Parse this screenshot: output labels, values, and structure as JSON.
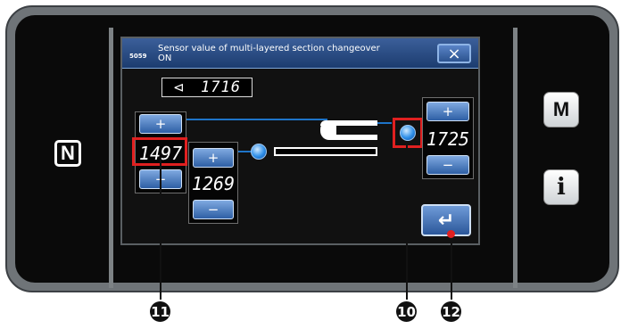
{
  "dialog": {
    "code": "5059",
    "title": "Sensor value of multi-layered section changeover ON",
    "close_icon": "×"
  },
  "sensor_display": {
    "icon": "sensor-icon",
    "glyph": "⊲",
    "value": "1716"
  },
  "values": {
    "left": "1497",
    "middle": "1269",
    "right": "1725"
  },
  "buttons": {
    "plus": "+",
    "minus": "−",
    "enter": "↵"
  },
  "side_buttons": {
    "m_label": "M",
    "info_label": "i",
    "nfc_label": "N"
  },
  "callouts": {
    "c11": "11",
    "c10": "10",
    "c12": "12"
  },
  "colors": {
    "accent_blue": "#2e5fa5",
    "highlight_red": "#e02020"
  }
}
